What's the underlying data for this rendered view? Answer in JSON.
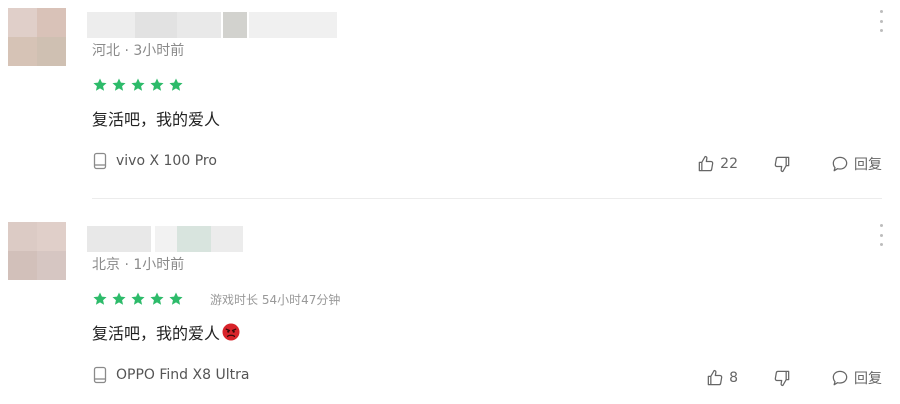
{
  "reviews": [
    {
      "location": "河北",
      "time": "3小时前",
      "rating": 5,
      "content": "复活吧，我的爱人",
      "emoji": "",
      "device": "vivo X 100 Pro",
      "likes": "22",
      "reply_label": "回复"
    },
    {
      "location": "北京",
      "time": "1小时前",
      "rating": 5,
      "playtime": "游戏时长 54小时47分钟",
      "content": "复活吧，我的爱人",
      "emoji": "angry-face",
      "device": "OPPO Find X8 Ultra",
      "likes": "8",
      "reply_label": "回复"
    }
  ],
  "colors": {
    "star": "#2dbb6a",
    "muted": "#8a8a8a",
    "divider": "#ececec",
    "angry_emoji": "#d8232a"
  },
  "icons": {
    "device": "phone-icon",
    "like": "thumbs-up-icon",
    "dislike": "thumbs-down-icon",
    "reply": "speech-bubble-icon",
    "more": "vertical-ellipsis-icon"
  }
}
